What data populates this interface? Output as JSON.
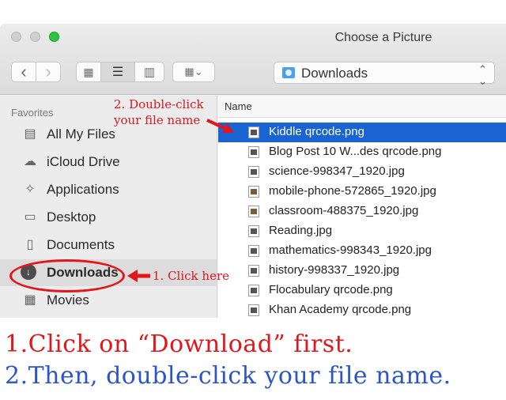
{
  "window": {
    "title": "Choose a Picture",
    "location": "Downloads"
  },
  "toolbar": {
    "back_glyph": "‹",
    "forward_glyph": "›",
    "view_icons_glyph": "▦",
    "view_list_glyph": "☰",
    "view_columns_glyph": "▥",
    "arrange_glyph": "▦⌄",
    "location_chevron": "⌃⌄"
  },
  "sidebar": {
    "header": "Favorites",
    "items": [
      {
        "label": "All My Files",
        "icon": "all-files-icon",
        "glyph": "▤"
      },
      {
        "label": "iCloud Drive",
        "icon": "cloud-icon",
        "glyph": "☁"
      },
      {
        "label": "Applications",
        "icon": "applications-icon",
        "glyph": "✧"
      },
      {
        "label": "Desktop",
        "icon": "desktop-icon",
        "glyph": "▭"
      },
      {
        "label": "Documents",
        "icon": "documents-icon",
        "glyph": "▯"
      },
      {
        "label": "Downloads",
        "icon": "downloads-icon",
        "glyph": "↓",
        "selected": true
      },
      {
        "label": "Movies",
        "icon": "movies-icon",
        "glyph": "▦"
      }
    ]
  },
  "filelist": {
    "column_header": "Name",
    "rows": [
      {
        "name": "Kiddle qrcode.png",
        "selected": true
      },
      {
        "name": "Blog Post 10 W...des qrcode.png"
      },
      {
        "name": "science-998347_1920.jpg"
      },
      {
        "name": "mobile-phone-572865_1920.jpg",
        "photo": true
      },
      {
        "name": "classroom-488375_1920.jpg",
        "photo": true
      },
      {
        "name": "Reading.jpg"
      },
      {
        "name": "mathematics-998343_1920.jpg"
      },
      {
        "name": "history-998337_1920.jpg"
      },
      {
        "name": "Flocabulary qrcode.png"
      },
      {
        "name": "Khan Academy qrcode.png"
      }
    ]
  },
  "annotations": {
    "step2_line1": "2. Double-click",
    "step2_line2": "your file name",
    "step1": "1. Click here",
    "instruction_1": "1.Click on “Download” first.",
    "instruction_2": "2.Then, double-click your file name."
  },
  "colors": {
    "annotation_red": "#e2171d",
    "annotation_blue": "#2b55c8",
    "selection_blue": "#1a63d3",
    "maximize_green": "#2ec440"
  }
}
